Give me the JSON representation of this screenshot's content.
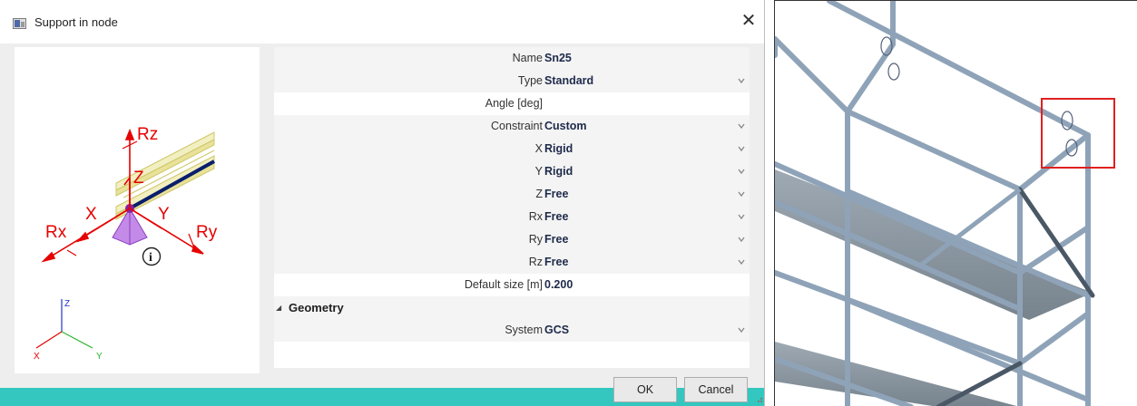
{
  "window": {
    "title": "Support in node",
    "close_glyph": "✕"
  },
  "preview": {
    "labels": {
      "rz": "Rz",
      "z": "Z",
      "x": "X",
      "y": "Y",
      "rx": "Rx",
      "ry": "Ry",
      "info": "i",
      "axis_z": "Z",
      "axis_x": "X",
      "axis_y": "Y"
    },
    "colors": {
      "arrow": "#e60000",
      "support": "#b36be0",
      "beam": "#e8e29a",
      "member": "#0a1f6b",
      "axis_x": "#e60000",
      "axis_y": "#2db52d",
      "axis_z": "#2233cc"
    }
  },
  "properties": {
    "name": {
      "label": "Name",
      "value": "Sn25"
    },
    "type": {
      "label": "Type",
      "value": "Standard"
    },
    "angle": {
      "label": "Angle [deg]",
      "value": ""
    },
    "constraint": {
      "label": "Constraint",
      "value": "Custom"
    },
    "x": {
      "label": "X",
      "value": "Rigid"
    },
    "y": {
      "label": "Y",
      "value": "Rigid"
    },
    "z": {
      "label": "Z",
      "value": "Free"
    },
    "rx": {
      "label": "Rx",
      "value": "Free"
    },
    "ry": {
      "label": "Ry",
      "value": "Free"
    },
    "rz": {
      "label": "Rz",
      "value": "Free"
    },
    "default_size": {
      "label": "Default size [m]",
      "value": "0.200"
    },
    "geometry_section": {
      "label": "Geometry"
    },
    "system": {
      "label": "System",
      "value": "GCS"
    }
  },
  "buttons": {
    "ok": "OK",
    "cancel": "Cancel"
  },
  "colors": {
    "accent_footer": "#33c7c0",
    "value_text": "#1e2a4a",
    "highlight_box": "#e02020"
  }
}
